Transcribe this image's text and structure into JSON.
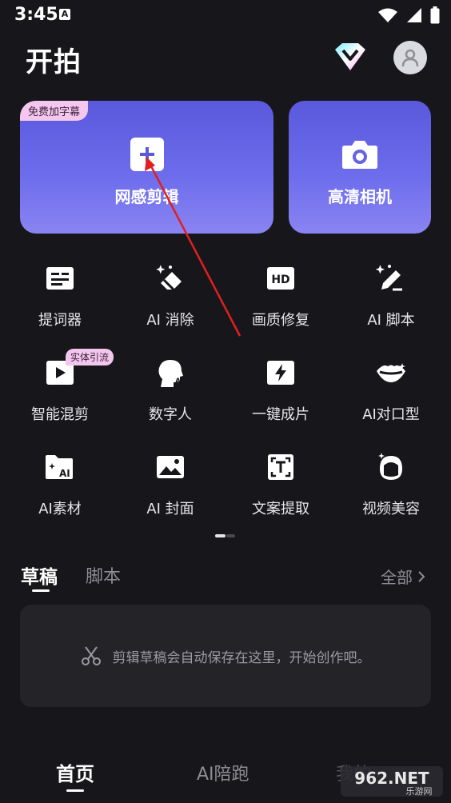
{
  "status_bar": {
    "time": "3:45",
    "indicator": "A"
  },
  "header": {
    "title": "开拍"
  },
  "cards": {
    "edit": {
      "badge": "免费加字幕",
      "label": "网感剪辑"
    },
    "camera": {
      "label": "高清相机"
    }
  },
  "tools": [
    {
      "label": "提词器",
      "icon": "teleprompter-icon"
    },
    {
      "label": "AI 消除",
      "icon": "eraser-icon"
    },
    {
      "label": "画质修复",
      "icon": "hd-icon"
    },
    {
      "label": "AI 脚本",
      "icon": "pen-sparkle-icon"
    },
    {
      "label": "智能混剪",
      "icon": "play-square-icon",
      "badge": "实体引流"
    },
    {
      "label": "数字人",
      "icon": "ai-head-icon"
    },
    {
      "label": "一键成片",
      "icon": "lightning-icon"
    },
    {
      "label": "AI对口型",
      "icon": "lips-icon"
    },
    {
      "label": "AI素材",
      "icon": "ai-folder-icon"
    },
    {
      "label": "AI 封面",
      "icon": "image-icon"
    },
    {
      "label": "文案提取",
      "icon": "text-scan-icon"
    },
    {
      "label": "视频美容",
      "icon": "face-sparkle-icon"
    }
  ],
  "drafts": {
    "tab_drafts": "草稿",
    "tab_scripts": "脚本",
    "view_all": "全部",
    "empty_text": "剪辑草稿会自动保存在这里，开始创作吧。"
  },
  "bottom_nav": {
    "home": "首页",
    "ai": "AI陪跑",
    "mine": "我的"
  },
  "watermark": {
    "text": "962.NET",
    "sub": "乐游网"
  },
  "colors": {
    "background": "#17171b",
    "card_gradient_start": "#5a59dc",
    "card_gradient_end": "#8a84f2",
    "badge_pink": "#f4c7ef",
    "arrow_red": "#e02020"
  }
}
